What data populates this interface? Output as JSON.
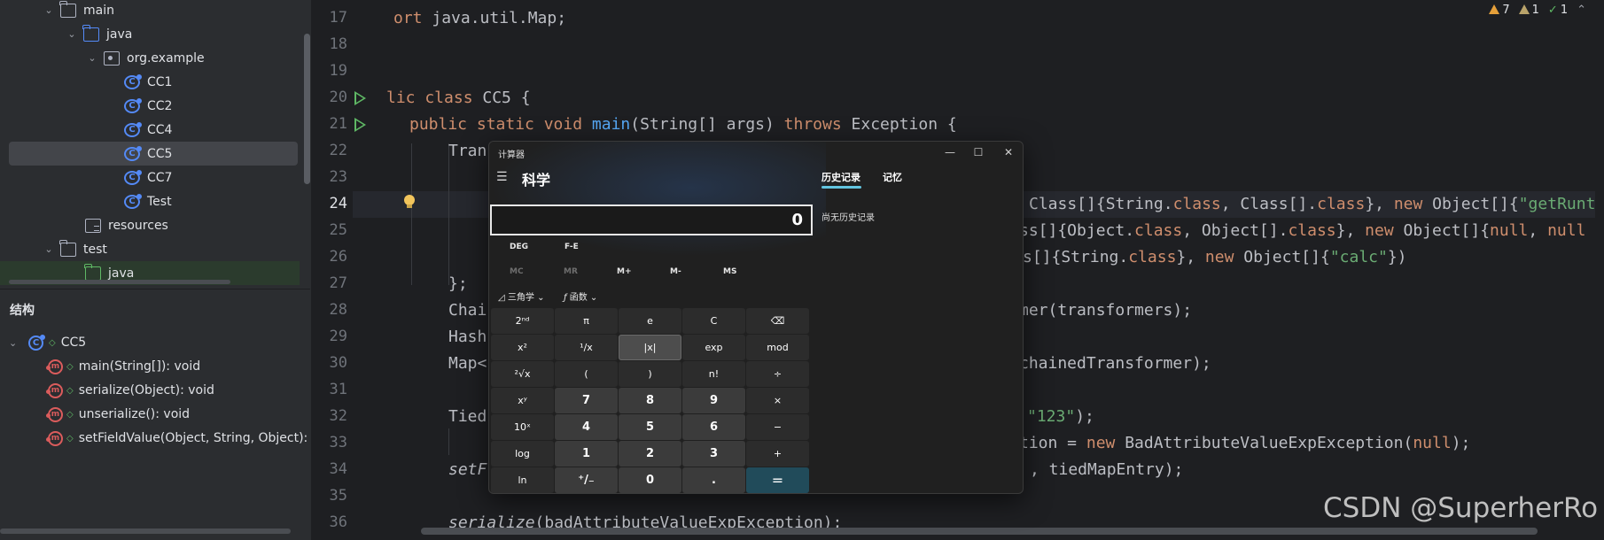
{
  "project_tree": {
    "items": [
      {
        "label": "main",
        "depth": 2,
        "icon": "folder-icon",
        "expanded": true
      },
      {
        "label": "java",
        "depth": 3,
        "icon": "source-folder-icon",
        "expanded": true
      },
      {
        "label": "org.example",
        "depth": 4,
        "icon": "package-icon",
        "expanded": true
      },
      {
        "label": "CC1",
        "depth": 5,
        "icon": "class-icon"
      },
      {
        "label": "CC2",
        "depth": 5,
        "icon": "class-icon"
      },
      {
        "label": "CC4",
        "depth": 5,
        "icon": "class-icon"
      },
      {
        "label": "CC5",
        "depth": 5,
        "icon": "class-icon",
        "selected": true
      },
      {
        "label": "CC7",
        "depth": 5,
        "icon": "class-icon"
      },
      {
        "label": "Test",
        "depth": 5,
        "icon": "class-icon"
      },
      {
        "label": "resources",
        "depth": 3,
        "icon": "resources-folder-icon"
      },
      {
        "label": "test",
        "depth": 2,
        "icon": "folder-icon",
        "expanded": true
      },
      {
        "label": "java",
        "depth": 3,
        "icon": "test-folder-icon"
      }
    ]
  },
  "structure": {
    "title": "结构",
    "root": "CC5",
    "members": [
      "main(String[]): void",
      "serialize(Object): void",
      "unserialize(): void",
      "setFieldValue(Object, String, Object): voi"
    ]
  },
  "editor": {
    "inspections": {
      "warnings": "7",
      "weak_warnings": "1",
      "ok": "1"
    },
    "line_numbers": [
      "17",
      "18",
      "19",
      "20",
      "21",
      "22",
      "23",
      "24",
      "25",
      "26",
      "27",
      "28",
      "29",
      "30",
      "31",
      "32",
      "33",
      "34",
      "35",
      "36"
    ]
  },
  "calculator": {
    "window_title": "计算器",
    "mode": "科学",
    "display_value": "0",
    "angle_label": "DEG",
    "notation_label": "F-E",
    "memory_buttons": [
      "MC",
      "MR",
      "M+",
      "M-",
      "MS"
    ],
    "trig_label": "三角学",
    "func_label": "函数",
    "keys": [
      "2ⁿᵈ",
      "π",
      "e",
      "C",
      "⌫",
      "x²",
      "¹/x",
      "|x|",
      "exp",
      "mod",
      "²√x",
      "(",
      ")",
      "n!",
      "÷",
      "xʸ",
      "7",
      "8",
      "9",
      "×",
      "10ˣ",
      "4",
      "5",
      "6",
      "−",
      "log",
      "1",
      "2",
      "3",
      "+",
      "ln",
      "⁺/₋",
      "0",
      ".",
      "="
    ],
    "history_tab": "历史记录",
    "memory_tab": "记忆",
    "history_empty": "尚无历史记录"
  },
  "watermark": "CSDN @SuperherRo"
}
